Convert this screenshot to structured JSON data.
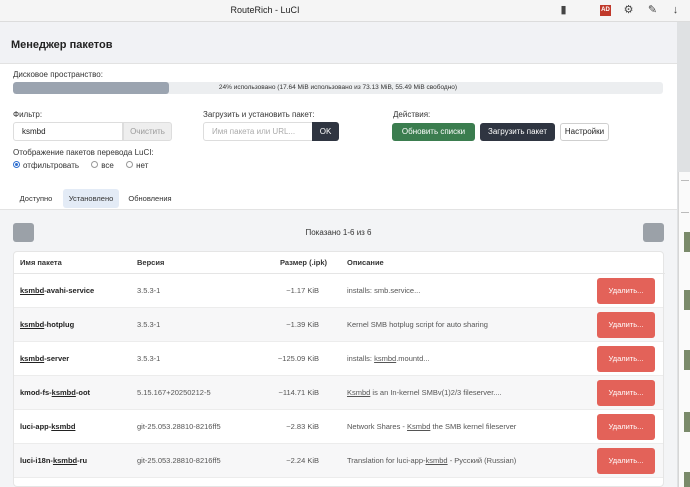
{
  "browser": {
    "title": "RouteRich - LuCI",
    "red_icon_label": "AD"
  },
  "modal": {
    "title": "Менеджер пакетов",
    "disk": {
      "label": "Дисковое пространство:",
      "usage_text": "24% использовано (17.64 MiB использовано из 73.13 MiB, 55.49 MiB свободно)",
      "percent": 24
    },
    "filter": {
      "label": "Фильтр:",
      "value": "ksmbd",
      "clear_label": "Очистить"
    },
    "upload": {
      "label": "Загрузить и установить пакет:",
      "placeholder": "Имя пакета или URL...",
      "ok_label": "OK"
    },
    "actions": {
      "label": "Действия:",
      "update_lists": "Обновить списки",
      "upload_package": "Загрузить пакет",
      "settings": "Настройки"
    },
    "translation": {
      "label": "Отображение пакетов перевода LuCI:",
      "options": [
        "отфильтровать",
        "все",
        "нет"
      ],
      "selected": "отфильтровать"
    },
    "tabs": [
      "Доступно",
      "Установлено",
      "Обновления"
    ],
    "active_tab": "Установлено",
    "showing": "Показано 1-6 из 6",
    "table": {
      "headers": [
        "Имя пакета",
        "Версия",
        "Размер (.ipk)",
        "Описание"
      ],
      "remove_label": "Удалить...",
      "rows": [
        {
          "name": "ksmbd-avahi-service",
          "version": "3.5.3-1",
          "size": "~1.17 KiB",
          "description": "installs: smb.service..."
        },
        {
          "name": "ksmbd-hotplug",
          "version": "3.5.3-1",
          "size": "~1.39 KiB",
          "description": "Kernel SMB hotplug script for auto sharing"
        },
        {
          "name": "ksmbd-server",
          "version": "3.5.3-1",
          "size": "~125.09 KiB",
          "description": "installs: ksmbd.mountd..."
        },
        {
          "name": "kmod-fs-ksmbd-oot",
          "version": "5.15.167+20250212-5",
          "size": "~114.71 KiB",
          "description": "Ksmbd is an In-kernel SMBv(1)2/3 fileserver...."
        },
        {
          "name": "luci-app-ksmbd",
          "version": "git-25.053.28810-8216ff5",
          "size": "~2.83 KiB",
          "description": "Network Shares - Ksmbd the SMB kernel fileserver"
        },
        {
          "name": "luci-i18n-ksmbd-ru",
          "version": "git-25.053.28810-8216ff5",
          "size": "~2.24 KiB",
          "description": "Translation for luci-app-ksmbd - Русский (Russian)"
        }
      ]
    }
  },
  "colors": {
    "primary_dark": "#2f3541",
    "success_green": "#3b7d4f",
    "danger_red": "#e36259",
    "header_bg": "#f1f2f5"
  }
}
